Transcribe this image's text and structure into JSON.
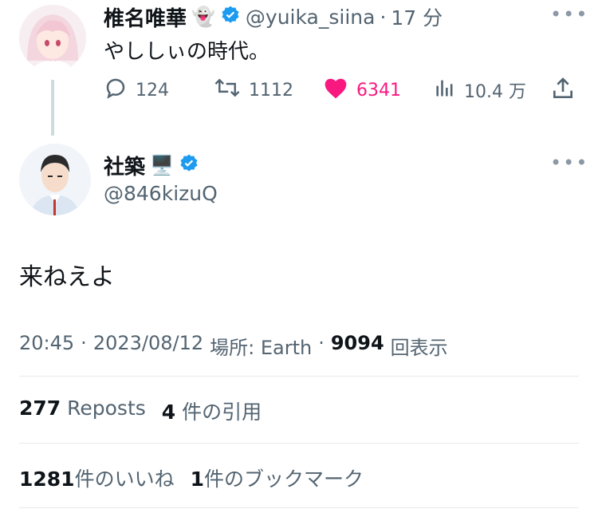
{
  "parent_tweet": {
    "display_name": "椎名唯華",
    "name_emoji": "👻",
    "handle": "@yuika_siina",
    "separator": "·",
    "time_ago": "17 分",
    "text": "やししぃの時代。",
    "actions": {
      "replies": "124",
      "reposts": "1112",
      "likes": "6341",
      "views": "10.4 万"
    }
  },
  "main_tweet": {
    "display_name": "社築",
    "name_emoji": "🖥️",
    "handle": "@846kizuQ",
    "text": "来ねえよ",
    "meta": {
      "time": "20:45",
      "dot1": "·",
      "date": "2023/08/12",
      "location": "場所: Earth",
      "dot2": "·",
      "views": "9094",
      "views_label": "回表示"
    },
    "stats_row1": {
      "reposts_count": "277",
      "reposts_label": "Reposts",
      "quotes_count": "4",
      "quotes_label": "件の引用"
    },
    "stats_row2": {
      "likes_count": "1281",
      "likes_label": "件のいいね",
      "bookmarks_count": "1",
      "bookmarks_label": "件のブックマーク"
    }
  },
  "colors": {
    "verified": "#1d9bf0",
    "like": "#f91880",
    "muted": "#536471",
    "divider": "#e6e9eb"
  },
  "icons": [
    "reply-icon",
    "repost-icon",
    "like-icon",
    "views-icon",
    "share-icon",
    "verified-icon",
    "more-icon"
  ]
}
